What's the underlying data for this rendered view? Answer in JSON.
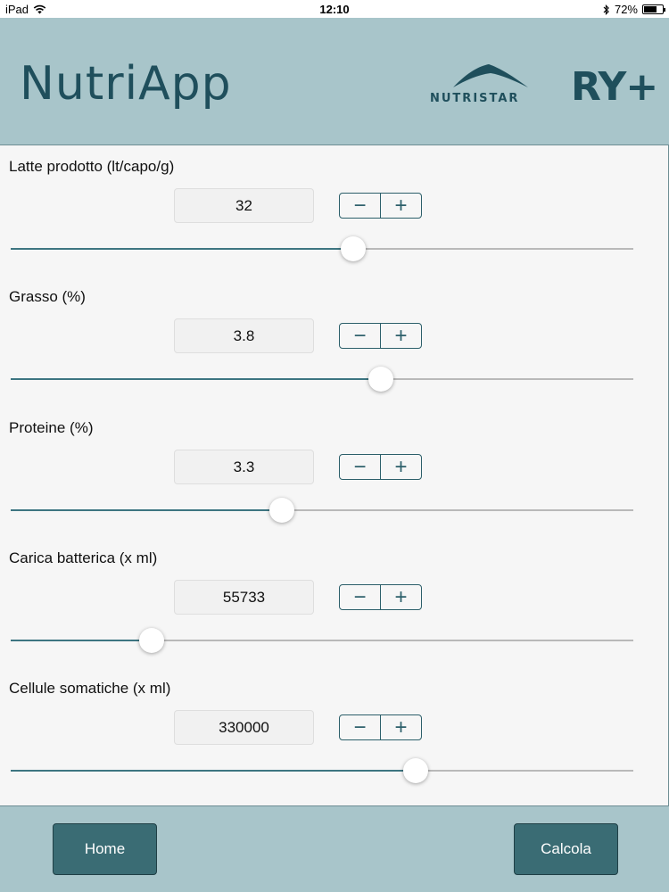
{
  "status_bar": {
    "device": "iPad",
    "time": "12:10",
    "battery": "72%",
    "battery_level": 0.72
  },
  "header": {
    "app_name": "NutriApp",
    "brand_nutristar": "NUTRISTAR",
    "brand_ry": "RY+"
  },
  "fields": [
    {
      "label": "Latte prodotto (lt/capo/g)",
      "value": "32",
      "slider_fraction": 0.55
    },
    {
      "label": "Grasso (%)",
      "value": "3.8",
      "slider_fraction": 0.595
    },
    {
      "label": "Proteine (%)",
      "value": "3.3",
      "slider_fraction": 0.436
    },
    {
      "label": "Carica batterica (x ml)",
      "value": "55733",
      "slider_fraction": 0.227
    },
    {
      "label": "Cellule somatiche (x ml)",
      "value": "330000",
      "slider_fraction": 0.65
    }
  ],
  "stepper": {
    "minus": "−",
    "plus": "+"
  },
  "footer": {
    "home_label": "Home",
    "calcola_label": "Calcola"
  },
  "colors": {
    "background": "#a8c5ca",
    "brand": "#1f4f5c",
    "button": "#3a6c74",
    "track_fill": "#3d7581"
  }
}
